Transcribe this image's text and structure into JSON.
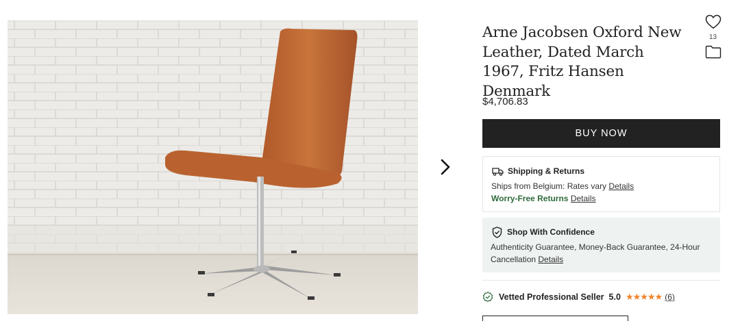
{
  "product": {
    "title": "Arne Jacobsen Oxford New Leather, Dated March 1967, Fritz Hansen Denmark",
    "price": "$4,706.83",
    "favorite_count": "13",
    "image_alt": "Orange leather swivel chair against white brick wall"
  },
  "actions": {
    "buy_now_label": "BUY NOW",
    "next_image_icon": "chevron-right-icon",
    "favorite_icon": "heart-icon",
    "folder_icon": "folder-icon"
  },
  "shipping": {
    "heading": "Shipping & Returns",
    "ships_from": "Ships from Belgium: Rates vary",
    "ships_details_link": "Details",
    "worry_free": "Worry-Free Returns",
    "worry_free_details_link": "Details"
  },
  "confidence": {
    "heading": "Shop With Confidence",
    "text": "Authenticity Guarantee, Money-Back Guarantee, 24-Hour Cancellation",
    "details_link": "Details"
  },
  "seller": {
    "label": "Vetted Professional Seller",
    "rating": "5.0",
    "stars": 5,
    "reviews": "(6)"
  },
  "colors": {
    "buy_button": "#222222",
    "green_text": "#2e6b3a",
    "confidence_bg": "#eef3f1",
    "star": "#f2832a",
    "chair_leather": "#c06a35"
  }
}
